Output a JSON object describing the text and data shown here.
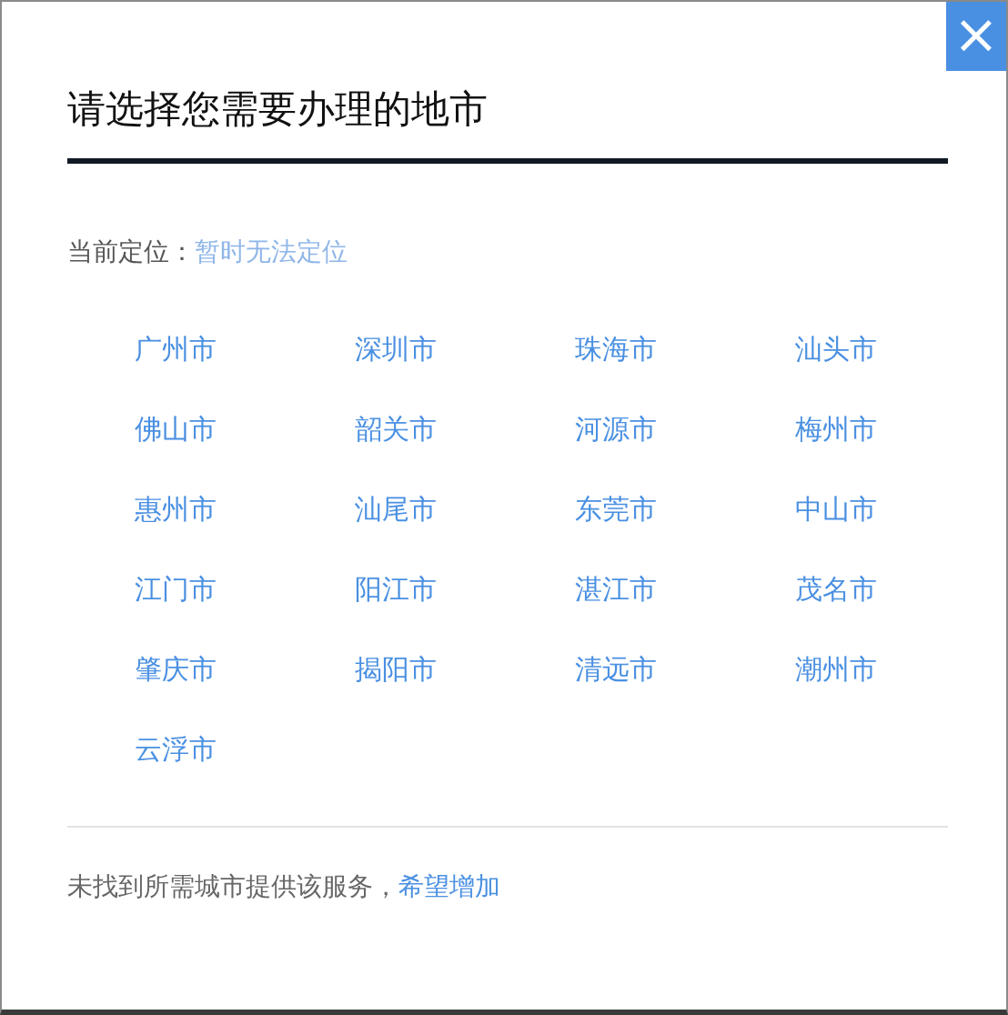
{
  "close_button": {
    "label": "×"
  },
  "title": "请选择您需要办理的地市",
  "location": {
    "label": "当前定位：",
    "value": "暂时无法定位"
  },
  "cities": [
    "广州市",
    "深圳市",
    "珠海市",
    "汕头市",
    "佛山市",
    "韶关市",
    "河源市",
    "梅州市",
    "惠州市",
    "汕尾市",
    "东莞市",
    "中山市",
    "江门市",
    "阳江市",
    "湛江市",
    "茂名市",
    "肇庆市",
    "揭阳市",
    "清远市",
    "潮州市",
    "云浮市"
  ],
  "footer": {
    "text": "未找到所需城市提供该服务，",
    "link": "希望增加"
  }
}
